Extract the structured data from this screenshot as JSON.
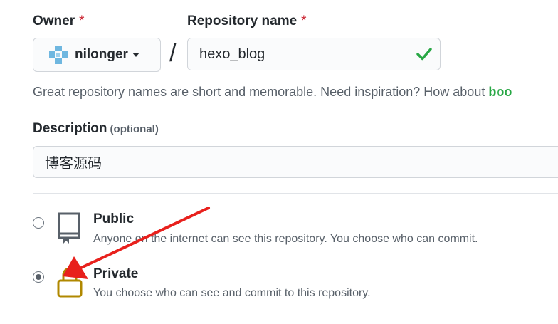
{
  "owner": {
    "label": "Owner",
    "required_mark": "*",
    "selected": "nilonger"
  },
  "repo": {
    "label": "Repository name",
    "required_mark": "*",
    "value": "hexo_blog",
    "separator": "/",
    "hint_text": "Great repository names are short and memorable. Need inspiration? How about ",
    "hint_suggestion": "boo"
  },
  "description": {
    "label": "Description",
    "optional": "(optional)",
    "value": "博客源码"
  },
  "visibility": {
    "public": {
      "title": "Public",
      "desc": "Anyone on the internet can see this repository. You choose who can commit.",
      "selected": false
    },
    "private": {
      "title": "Private",
      "desc": "You choose who can see and commit to this repository.",
      "selected": true
    }
  },
  "colors": {
    "check": "#28a745",
    "annotation_arrow": "#e8201c",
    "lock": "#b08800",
    "book": "#586069",
    "required": "#cb2431"
  }
}
